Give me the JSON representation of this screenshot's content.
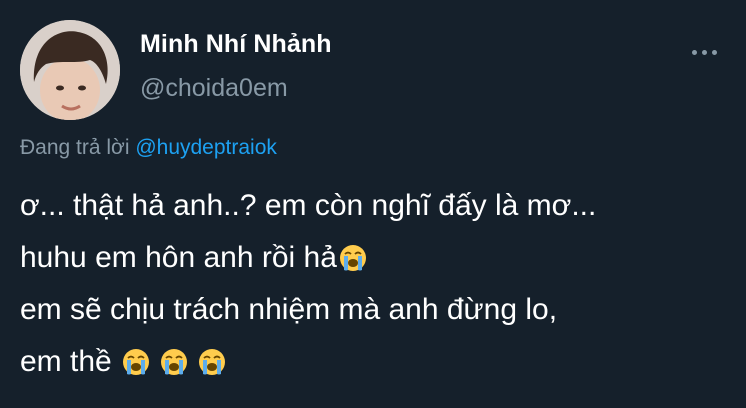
{
  "author": {
    "display_name": "Minh Nhí Nhảnh",
    "handle": "@choida0em"
  },
  "reply": {
    "prefix": "Đang trả lời ",
    "mention": "@huydeptraiok"
  },
  "body": {
    "line1": "ơ... thật hả anh..? em còn nghĩ đấy là mơ...",
    "line2": "huhu em hôn anh rồi hả",
    "line3": "em sẽ chịu trách nhiệm mà anh đừng lo,",
    "line4": "em thề "
  },
  "icons": {
    "more": "more-options-icon",
    "emoji": "loudly-crying-face-icon"
  },
  "colors": {
    "background": "#15202b",
    "text": "#ffffff",
    "secondary": "#8899a6",
    "link": "#1da1f2"
  }
}
